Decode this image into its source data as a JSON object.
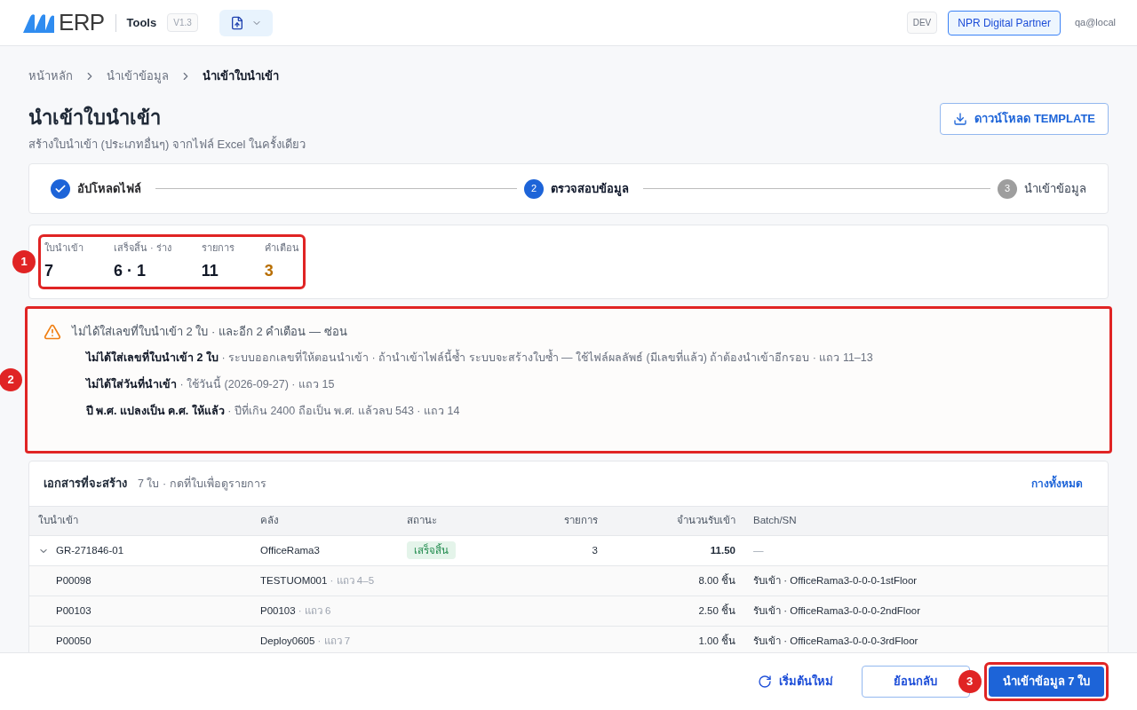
{
  "header": {
    "brand": "ERP",
    "app": "Tools",
    "version": "V1.3",
    "env": "DEV",
    "org": "NPR Digital Partner",
    "user": "qa@local"
  },
  "breadcrumb": [
    {
      "label": "หน้าหลัก",
      "current": false
    },
    {
      "label": "นำเข้าข้อมูล",
      "current": false
    },
    {
      "label": "นำเข้าใบนำเข้า",
      "current": true
    }
  ],
  "page": {
    "title": "นำเข้าใบนำเข้า",
    "subtitle": "สร้างใบนำเข้า (ประเภทอื่นๆ) จากไฟล์ Excel ในครั้งเดียว",
    "download_button": "ดาวน์โหลด TEMPLATE"
  },
  "steps": [
    {
      "label": "อัปโหลดไฟล์",
      "completed": true,
      "selected": false
    },
    {
      "number": "2",
      "label": "ตรวจสอบข้อมูล",
      "completed": false,
      "selected": true
    },
    {
      "number": "3",
      "label": "นำเข้าข้อมูล",
      "completed": false,
      "selected": false
    }
  ],
  "stats": {
    "annotation": "1",
    "items": [
      {
        "label": "ใบนำเข้า",
        "value": "7",
        "warning": false
      },
      {
        "label": "เสร็จสิ้น · ร่าง",
        "value": "6 · 1",
        "warning": false
      },
      {
        "label": "รายการ",
        "value": "11",
        "warning": false
      },
      {
        "label": "คำเตือน",
        "value": "3",
        "warning": true
      }
    ]
  },
  "warnings": {
    "annotation": "2",
    "summary": "ไม่ได้ใส่เลขที่ใบนำเข้า 2 ใบ · และอีก 2 คำเตือน — ซ่อน",
    "items": [
      {
        "title": "ไม่ได้ใส่เลขที่ใบนำเข้า 2 ใบ",
        "detail": " · ระบบออกเลขที่ให้ตอนนำเข้า · ถ้านำเข้าไฟล์นี้ซ้ำ ระบบจะสร้างใบซ้ำ — ใช้ไฟล์ผลลัพธ์ (มีเลขที่แล้ว) ถ้าต้องนำเข้าอีกรอบ · แถว 11–13"
      },
      {
        "title": "ไม่ได้ใส่วันที่นำเข้า",
        "detail": " · ใช้วันนี้ (2026-09-27) · แถว 15"
      },
      {
        "title": "ปี พ.ศ. แปลงเป็น ค.ศ. ให้แล้ว",
        "detail": " · ปีที่เกิน 2400 ถือเป็น พ.ศ. แล้วลบ 543 · แถว 14"
      }
    ]
  },
  "documents": {
    "title": "เอกสารที่จะสร้าง",
    "subtitle": "7 ใบ · กดที่ใบเพื่อดูรายการ",
    "expand_all": "กางทั้งหมด",
    "columns": [
      "ใบนำเข้า",
      "คลัง",
      "สถานะ",
      "รายการ",
      "จำนวนรับเข้า",
      "Batch/SN"
    ],
    "rows": [
      {
        "kind": "document",
        "expanded": true,
        "doc": "GR-271846-01",
        "warehouse": "OfficeRama3",
        "status": "เสร็จสิ้น",
        "items": "3",
        "qty": "11.50",
        "batch": "—"
      },
      {
        "kind": "line",
        "doc": "P00098",
        "warehouse": "TESTUOM001",
        "row_ref": " · แถว 4–5",
        "qty": "8.00 ชิ้น",
        "batch": "รับเข้า · OfficeRama3-0-0-0-1stFloor"
      },
      {
        "kind": "line",
        "doc": "P00103",
        "warehouse": "P00103",
        "row_ref": " · แถว 6",
        "qty": "2.50 ชิ้น",
        "batch": "รับเข้า · OfficeRama3-0-0-0-2ndFloor"
      },
      {
        "kind": "line",
        "doc": "P00050",
        "warehouse": "Deploy0605",
        "row_ref": " · แถว 7",
        "qty": "1.00 ชิ้น",
        "batch": "รับเข้า · OfficeRama3-0-0-0-3rdFloor"
      }
    ]
  },
  "footer": {
    "restart": "เริ่มต้นใหม่",
    "back": "ย้อนกลับ",
    "submit": "นำเข้าข้อมูล 7 ใบ",
    "submit_annotation": "3"
  }
}
